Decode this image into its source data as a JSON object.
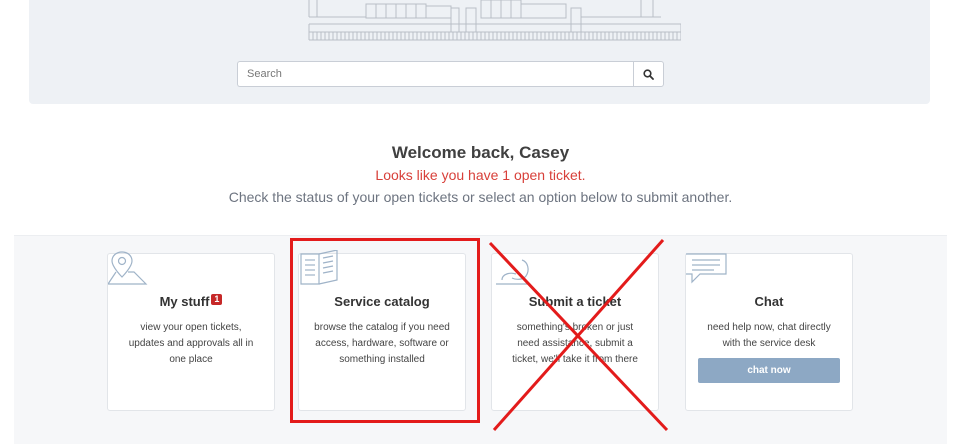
{
  "search": {
    "placeholder": "Search"
  },
  "welcome": {
    "title": "Welcome back, Casey",
    "open_tickets": "Looks like you have 1 open ticket.",
    "subtitle": "Check the status of your open tickets or select an option below to submit another."
  },
  "cards": [
    {
      "title": "My stuff",
      "badge": "1",
      "description": "view your open tickets, updates and approvals all in one place",
      "icon": "map-pin-icon"
    },
    {
      "title": "Service catalog",
      "description": "browse the catalog if you need access, hardware, software or something installed",
      "icon": "book-icon"
    },
    {
      "title": "Submit a ticket",
      "description": "something's broken or just need assistance, submit a ticket, we'll take it from there",
      "icon": "support-icon"
    },
    {
      "title": "Chat",
      "description": "need help now, chat directly with the service desk",
      "button": "chat now",
      "icon": "chat-bubble-icon"
    }
  ],
  "annotations": {
    "highlight_color": "#e31b1b"
  }
}
